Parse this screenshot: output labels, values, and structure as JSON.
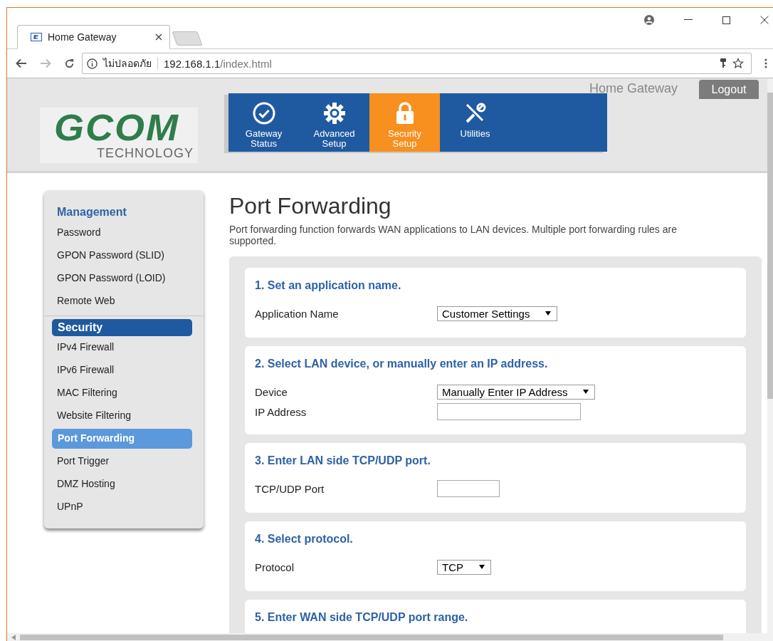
{
  "browser": {
    "tab_title": "Home Gateway",
    "security_label": "ไม่ปลอดภัย",
    "url_host": "192.168.1.1",
    "url_path": "/index.html"
  },
  "header": {
    "logo_text": "GCOM",
    "logo_subtext": "TECHNOLOGY",
    "product_name": "Home Gateway",
    "logout": "Logout",
    "nav": [
      {
        "label": "Gateway Status",
        "kind": "check",
        "selected": false
      },
      {
        "label": "Advanced Setup",
        "kind": "gear",
        "selected": false
      },
      {
        "label": "Security Setup",
        "kind": "lock",
        "selected": true
      },
      {
        "label": "Utilities",
        "kind": "tools",
        "selected": false
      }
    ]
  },
  "sidebar": [
    {
      "title": "Management",
      "selected": false,
      "items": [
        {
          "label": "Password",
          "selected": false
        },
        {
          "label": "GPON Password (SLID)",
          "selected": false
        },
        {
          "label": "GPON Password (LOID)",
          "selected": false
        },
        {
          "label": "Remote Web",
          "selected": false
        }
      ]
    },
    {
      "title": "Security",
      "selected": true,
      "items": [
        {
          "label": "IPv4 Firewall",
          "selected": false
        },
        {
          "label": "IPv6 Firewall",
          "selected": false
        },
        {
          "label": "MAC Filtering",
          "selected": false
        },
        {
          "label": "Website Filtering",
          "selected": false
        },
        {
          "label": "Port Forwarding",
          "selected": true
        },
        {
          "label": "Port Trigger",
          "selected": false
        },
        {
          "label": "DMZ Hosting",
          "selected": false
        },
        {
          "label": "UPnP",
          "selected": false
        }
      ]
    }
  ],
  "page": {
    "title": "Port Forwarding",
    "description": "Port forwarding function forwards WAN applications to LAN devices. Multiple port forwarding rules are supported.",
    "sections": [
      {
        "title": "1. Set an application name.",
        "fields": [
          {
            "label": "Application Name",
            "kind": "select",
            "value": "Customer Settings"
          }
        ]
      },
      {
        "title": "2. Select LAN device, or manually enter an IP address.",
        "fields": [
          {
            "label": "Device",
            "kind": "select",
            "value": "Manually Enter IP Address"
          },
          {
            "label": "IP Address",
            "kind": "input"
          }
        ]
      },
      {
        "title": "3. Enter LAN side TCP/UDP port.",
        "fields": [
          {
            "label": "TCP/UDP Port",
            "kind": "port"
          }
        ]
      },
      {
        "title": "4. Select protocol.",
        "fields": [
          {
            "label": "Protocol",
            "kind": "select",
            "value": "TCP"
          }
        ]
      },
      {
        "title": "5. Enter WAN side TCP/UDP port range."
      }
    ]
  }
}
